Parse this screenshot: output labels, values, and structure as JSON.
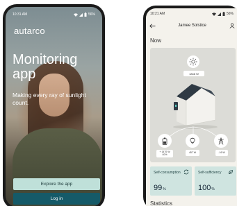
{
  "left": {
    "status_time": "10:31 AM",
    "status_battery": "56%",
    "brand": "autarco",
    "hero_title": "Monitoring app",
    "hero_subtitle": "Making every ray of sunlight count.",
    "explore_button": "Explore the app",
    "login_button": "Log in",
    "colors": {
      "explore": "#bfe0d9",
      "login": "#155a68"
    }
  },
  "right": {
    "status_time": "10:21 AM",
    "status_battery": "56%",
    "header_title": "Jamee Solstice",
    "now_heading": "Now",
    "solar_value": "1848 W",
    "battery_value": "+ 1470 W\n40%",
    "home_value": "457 W",
    "grid_value": "-16 W",
    "self_consumption": {
      "label": "Self-consumption",
      "value": "99",
      "unit": "%"
    },
    "self_sufficiency": {
      "label": "Self-sufficiency",
      "value": "100",
      "unit": "%"
    },
    "statistics_heading": "Statistics",
    "icons": [
      "back-arrow-icon",
      "user-icon",
      "sun-icon",
      "battery-icon",
      "lightbulb-icon",
      "power-tower-icon",
      "refresh-icon",
      "leaf-icon"
    ]
  }
}
